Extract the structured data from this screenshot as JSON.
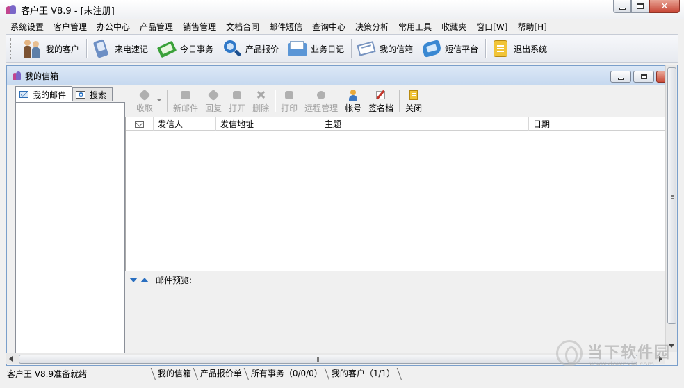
{
  "window": {
    "title": "客户王 V8.9 - [未注册]",
    "close_glyph": "✕"
  },
  "menu": [
    "系统设置",
    "客户管理",
    "办公中心",
    "产品管理",
    "销售管理",
    "文档合同",
    "邮件短信",
    "查询中心",
    "决策分析",
    "常用工具",
    "收藏夹",
    "窗口[W]",
    "帮助[H]"
  ],
  "toolbar": {
    "my_customers": "我的客户",
    "call_log": "来电速记",
    "today_tasks": "今日事务",
    "product_quote": "产品报价",
    "business_diary": "业务日记",
    "my_mailbox": "我的信箱",
    "sms_platform": "短信平台",
    "exit_system": "退出系统"
  },
  "mailbox_window": {
    "title": "我的信箱",
    "close_glyph": "✕",
    "tabs": {
      "my_mail": "我的邮件",
      "search": "搜索"
    },
    "mail_toolbar": {
      "receive": "收取",
      "new_mail": "新邮件",
      "reply": "回复",
      "open": "打开",
      "delete": "删除",
      "print": "打印",
      "remote_manage": "远程管理",
      "account": "帐号",
      "signature": "签名档",
      "close": "关闭"
    },
    "columns": {
      "sender": "发信人",
      "sender_address": "发信地址",
      "subject": "主题",
      "date": "日期"
    },
    "preview_label": "邮件预览:"
  },
  "status": {
    "text": "客户王 V8.9准备就绪",
    "window_tabs": [
      "我的信箱",
      "产品报价单",
      "所有事务（0/0/0）",
      "我的客户（1/1）"
    ]
  },
  "watermark": {
    "name": "当下软件园",
    "url": "www.downxia.com"
  },
  "colors": {
    "titlebar_bg": "#eef0f3",
    "child_title_bg": "#c5d8ef",
    "close_button": "#c74535",
    "accent_blue": "#2a6fc0"
  }
}
